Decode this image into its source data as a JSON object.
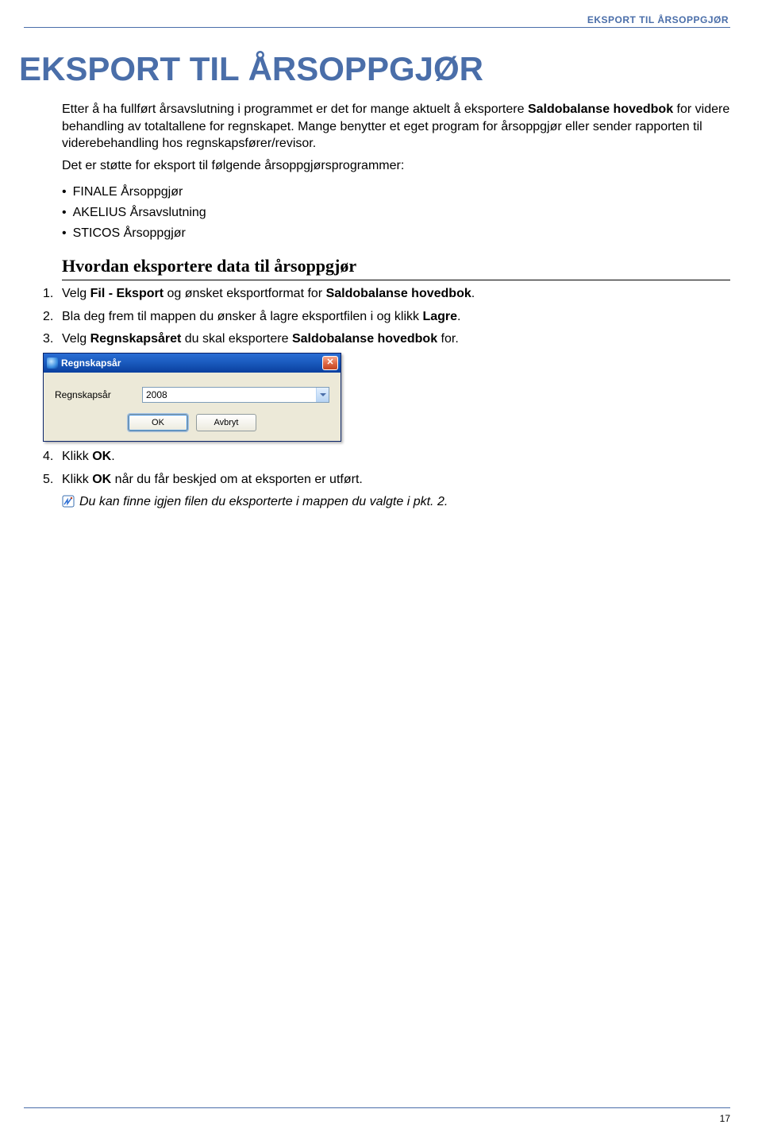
{
  "header": {
    "running_title": "EKSPORT TIL ÅRSOPPGJØR"
  },
  "title": "EKSPORT TIL ÅRSOPPGJØR",
  "intro": {
    "p1_a": "Etter å ha fullført årsavslutning i programmet er det for mange aktuelt å eksportere ",
    "p1_b": "Saldobalanse hovedbok",
    "p1_c": " for videre behandling av totaltallene for regnskapet. Mange benytter et eget program for årsoppgjør eller sender rapporten til viderebehandling hos regnskapsfører/revisor.",
    "p2": "Det er støtte for eksport til følgende årsoppgjørsprogrammer:"
  },
  "bullets": [
    "FINALE Årsoppgjør",
    "AKELIUS Årsavslutning",
    "STICOS Årsoppgjør"
  ],
  "subheading": "Hvordan eksportere data til årsoppgjør",
  "steps": {
    "s1_a": "Velg ",
    "s1_b": "Fil - Eksport",
    "s1_c": " og ønsket eksportformat for ",
    "s1_d": "Saldobalanse hovedbok",
    "s1_e": ".",
    "s2_a": "Bla deg frem til mappen du ønsker å lagre eksportfilen i og klikk ",
    "s2_b": "Lagre",
    "s2_c": ".",
    "s3_a": "Velg ",
    "s3_b": "Regnskapsåret",
    "s3_c": " du skal eksportere ",
    "s3_d": "Saldobalanse hovedbok",
    "s3_e": " for.",
    "s4_a": "Klikk ",
    "s4_b": "OK",
    "s4_c": ".",
    "s5_a": "Klikk ",
    "s5_b": "OK",
    "s5_c": " når du får beskjed om at eksporten er utført."
  },
  "dialog": {
    "title": "Regnskapsår",
    "field_label": "Regnskapsår",
    "field_value": "2008",
    "ok": "OK",
    "cancel": "Avbryt"
  },
  "tip": "Du kan finne igjen filen du eksporterte i mappen du valgte i pkt. 2.",
  "page_number": "17"
}
